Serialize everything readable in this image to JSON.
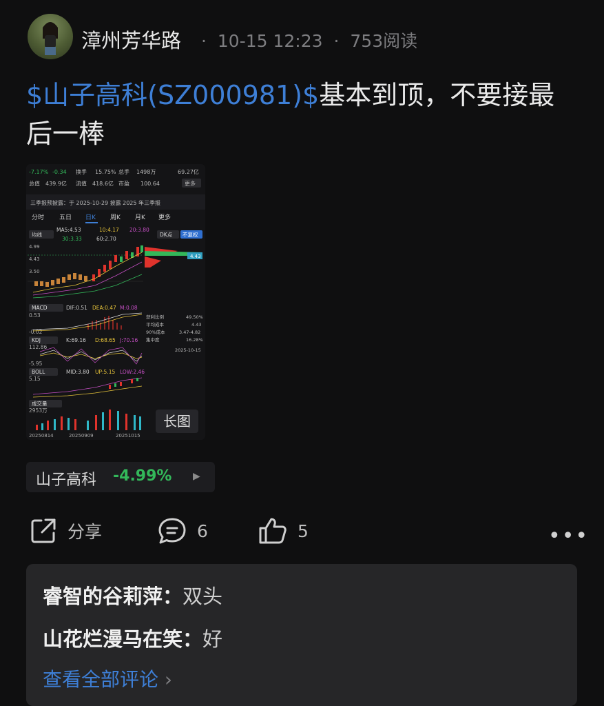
{
  "header": {
    "author": "漳州芳华路",
    "time": "10-15 12:23",
    "reads": "753阅读",
    "sep": "·"
  },
  "post": {
    "stock_link": "$山子高科(SZ000981)$",
    "text": "基本到顶，不要接最后一棒"
  },
  "chart_thumb": {
    "top_row1": [
      "-7.17%",
      "-0.34",
      "换手",
      "15.75%",
      "总手",
      "1498万",
      "69.27亿"
    ],
    "top_row2": [
      "总值",
      "439.9亿",
      "流值",
      "418.6亿",
      "市盈",
      "100.64",
      "更多"
    ],
    "notice": "三季报预披露：于 2025-10-29 披露 2025 年三季报",
    "tabs": [
      "分时",
      "五日",
      "日K",
      "周K",
      "月K",
      "更多"
    ],
    "ma": [
      "均线",
      "MA5:4.53",
      "10:4.17",
      "20:3.80",
      "30:3.33",
      "60:2.70"
    ],
    "dk_label": "DK点",
    "adj_label": "不复权",
    "price_tag": "4.43",
    "y_labels": [
      "4.99",
      "4.43",
      "3.50"
    ],
    "macd": [
      "MACD",
      "DIF:0.51",
      "DEA:0.47",
      "M:0.08"
    ],
    "macd_y": [
      "0.53",
      "-0.02"
    ],
    "kdj": [
      "KDJ",
      "K:69.16",
      "D:68.65",
      "J:70.16"
    ],
    "kdj_y": [
      "112.86",
      "-5.95"
    ],
    "boll": [
      "BOLL",
      "MID:3.80",
      "UP:5.15",
      "LOW:2.46"
    ],
    "boll_y": [
      "5.15"
    ],
    "vol": [
      "成交量",
      "2953万"
    ],
    "chip_dist": [
      "获利比例",
      "49.50%",
      "平均成本",
      "4.43",
      "90%成本",
      "3.47-4.82",
      "集中度",
      "16.28%"
    ],
    "chip_date": "2025-10-15",
    "x_dates": [
      "20250814",
      "20250909",
      "20251015"
    ],
    "long_image_label": "长图"
  },
  "stock_chip": {
    "name": "山子高科",
    "change": "-4.99%",
    "change_color": "#33b85a"
  },
  "actions": {
    "share_label": "分享",
    "comment_count": "6",
    "like_count": "5",
    "more": "•••"
  },
  "comments": {
    "items": [
      {
        "user": "睿智的谷莉萍：",
        "text": "双头"
      },
      {
        "user": "山花烂漫马在笑：",
        "text": "好"
      }
    ],
    "view_all": "查看全部评论",
    "view_all_arrow": "›"
  },
  "colors": {
    "link": "#3e7fd6",
    "down": "#33b85a",
    "up": "#e0332c"
  }
}
